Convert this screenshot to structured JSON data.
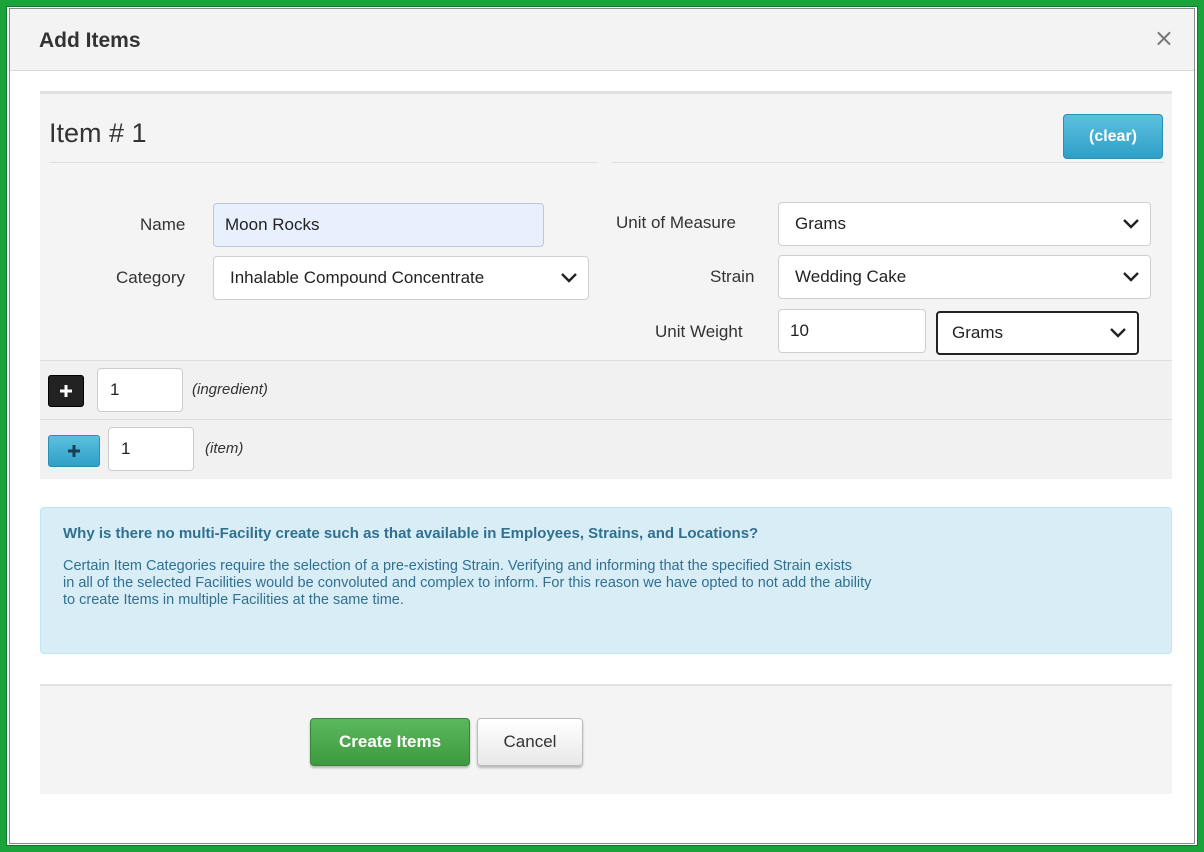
{
  "modal": {
    "title": "Add Items",
    "close_glyph": "×",
    "close_icon": "close-icon"
  },
  "item": {
    "heading": "Item # 1",
    "clear_label": "(clear)",
    "fields": {
      "name_label": "Name",
      "name_value": "Moon Rocks",
      "category_label": "Category",
      "category_value": "Inhalable Compound Concentrate",
      "uom_label": "Unit of Measure",
      "uom_value": "Grams",
      "strain_label": "Strain",
      "strain_value": "Wedding Cake",
      "unit_weight_label": "Unit Weight",
      "unit_weight_value": "10",
      "unit_weight_uom_value": "Grams"
    },
    "ingredient": {
      "qty": "1",
      "hint": "(ingredient)",
      "icon": "plus-icon"
    },
    "item_add": {
      "qty": "1",
      "hint": "(item)",
      "icon": "plus-icon"
    }
  },
  "info": {
    "title": "Why is there no multi-Facility create such as that available in Employees, Strains, and Locations?",
    "line1": "Certain Item Categories require the selection of a pre-existing Strain. Verifying and informing that the specified Strain exists",
    "line2": "in all of the selected Facilities would be convoluted and complex to inform. For this reason we have opted to not add the ability",
    "line3": "to create Items in multiple Facilities at the same time."
  },
  "footer": {
    "create_label": "Create Items",
    "cancel_label": "Cancel"
  },
  "colors": {
    "frame_green": "#1aa33a",
    "info_blue": "#31708f",
    "button_green": "#5cb85c",
    "button_blue": "#5bc0de"
  }
}
